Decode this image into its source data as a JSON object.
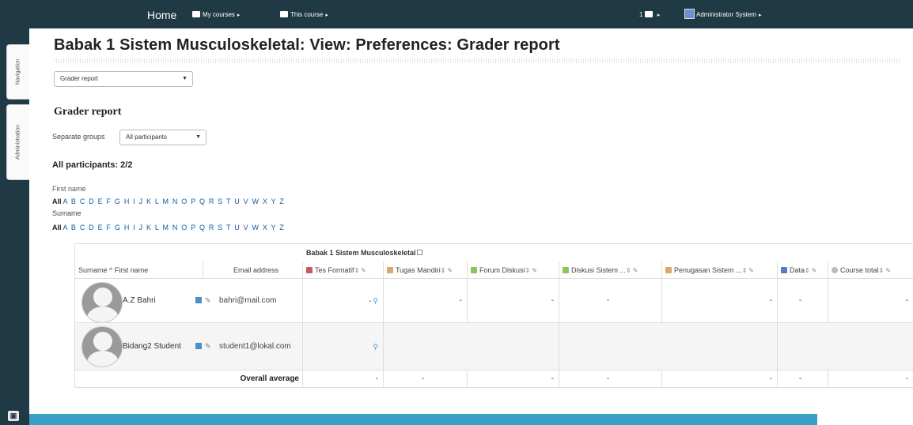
{
  "navbar": {
    "home": "Home",
    "my_courses": "My courses",
    "this_course": "This course",
    "messages_caret": "1",
    "user_name": "Administrator System"
  },
  "dock": {
    "navigation": "Navigation",
    "administration": "Administration"
  },
  "page": {
    "title": "Babak 1 Sistem Musculoskeletal: View: Preferences: Grader report",
    "report_select": "Grader report",
    "section_title": "Grader report",
    "groups_label": "Separate groups",
    "groups_value": "All participants",
    "participants_count": "All participants: 2/2",
    "firstname_label": "First name",
    "surname_label": "Surname",
    "letters_all": "All",
    "letters": "A B C D E F G H I J K L M N O P Q R S T U V W X Y Z"
  },
  "grader": {
    "category": "Babak 1 Sistem Musculoskeletal",
    "columns": {
      "name": "Surname ^ First name",
      "email": "Email address",
      "items": [
        "Tes Formatif",
        "Tugas Mandiri",
        "Forum Diskusi",
        "Diskusi Sistem ...",
        "Penugasan Sistem ...",
        "Data",
        "Course total"
      ]
    },
    "rows": [
      {
        "name": "A.Z Bahri",
        "email": "bahri@mail.com",
        "grades": [
          "-",
          "-",
          "-",
          "-",
          "-",
          "-",
          "-"
        ]
      },
      {
        "name": "Bidang2 Student",
        "email": "student1@lokal.com",
        "grades": [
          "",
          "",
          "",
          "",
          "",
          "",
          ""
        ]
      }
    ],
    "average": {
      "label": "Overall average",
      "values": [
        "-",
        "-",
        "-",
        "-",
        "-",
        "-",
        "-"
      ]
    }
  }
}
